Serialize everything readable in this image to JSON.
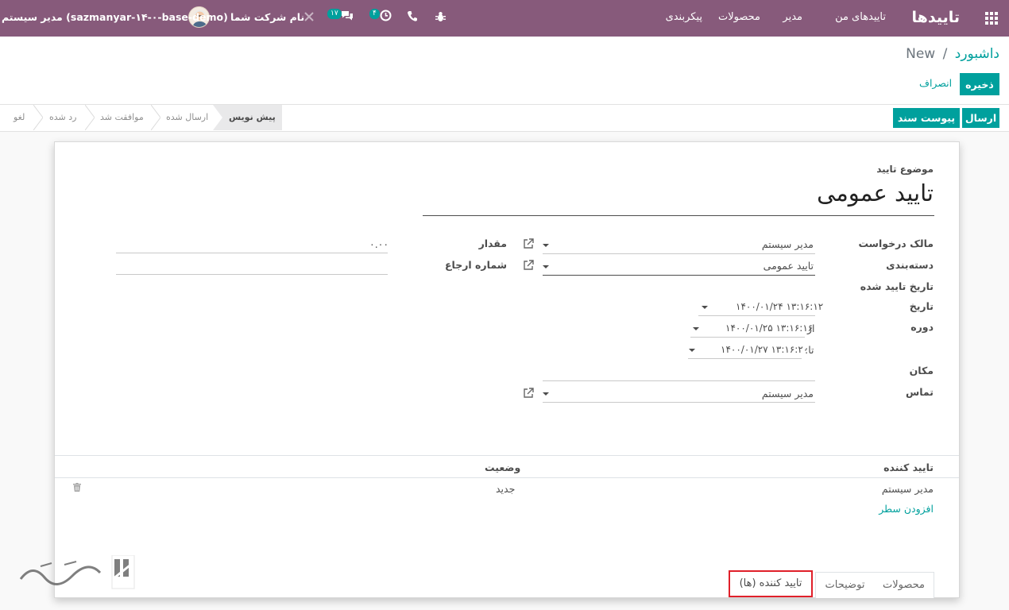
{
  "navbar": {
    "app_title": "تاییدها",
    "menu": [
      "تاییدهای من",
      "مدیر",
      "محصولات",
      "پیکربندی"
    ],
    "company": "نام شرکت شما",
    "user": "مدیر سیستم (sazmanyar-۱۴-۰-base-demo)",
    "messages_count": "۱۷",
    "activities_count": "۴"
  },
  "breadcrumb": {
    "parent": "داشبورد",
    "separator": "/",
    "current": "New"
  },
  "buttons": {
    "save": "ذخیره",
    "discard": "انصراف",
    "send": "ارسال",
    "attach": "پیوست سند"
  },
  "statusbar": {
    "stages": [
      "پیش نویس",
      "ارسال شده",
      "موافقت شد",
      "رد شده",
      "لغو"
    ],
    "active": "پیش نویس"
  },
  "form": {
    "subject_label": "موضوع تایید",
    "subject_value": "تایید عمومی",
    "fields": {
      "owner_label": "مالک درخواست",
      "owner_value": "مدیر سیستم",
      "category_label": "دسته‌بندی",
      "category_value": "تایید عمومی",
      "approval_date_label": "تاریخ تایید شده",
      "date_label": "تاریخ",
      "date_value": "۱۴۰۰/۰۱/۲۴ ۱۳:۱۶:۱۲",
      "period_label": "دوره",
      "from_label": "از",
      "from_value": "۱۴۰۰/۰۱/۲۵ ۱۳:۱۶:۱۶",
      "to_label": "تا:",
      "to_value": "۱۴۰۰/۰۱/۲۷ ۱۳:۱۶:۲۰",
      "location_label": "مکان",
      "contact_label": "تماس",
      "contact_value": "مدیر سیستم",
      "amount_label": "مقدار",
      "amount_value": "۰.۰۰",
      "reference_label": "شماره ارجاع"
    }
  },
  "tabs": [
    "محصولات",
    "توضیحات",
    "تایید کننده (ها)"
  ],
  "active_tab": "تایید کننده (ها)",
  "approvers_table": {
    "columns": [
      "تایید کننده",
      "وضعیت"
    ],
    "rows": [
      {
        "approver": "مدیر سیستم",
        "status": "جدید"
      }
    ],
    "add_line": "افزودن سطر"
  },
  "colors": {
    "brand": "#875a7b",
    "primary": "#00a09d",
    "highlight": "#e0202a"
  }
}
